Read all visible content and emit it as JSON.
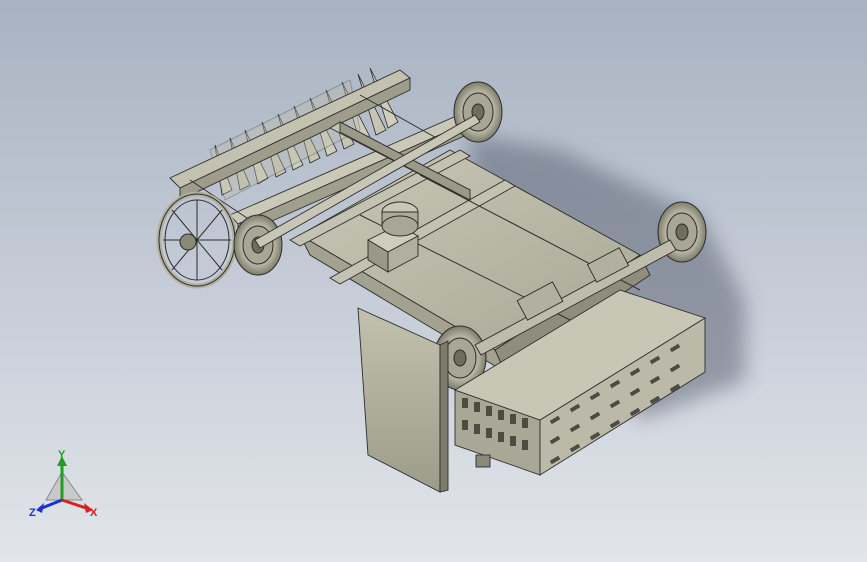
{
  "viewport": {
    "view": "isometric",
    "background_top": "#a9b2c1",
    "background_bottom": "#e2e5ea"
  },
  "model": {
    "name": "harvester-chassis-assembly",
    "part_color": "#b9b8a6",
    "part_shadow": "#8e8c7a",
    "edge_color": "#2d2d2d"
  },
  "triad": {
    "x_label": "X",
    "y_label": "Y",
    "z_label": "Z",
    "x_color": "#d82020",
    "y_color": "#20a020",
    "z_color": "#2030d0"
  }
}
